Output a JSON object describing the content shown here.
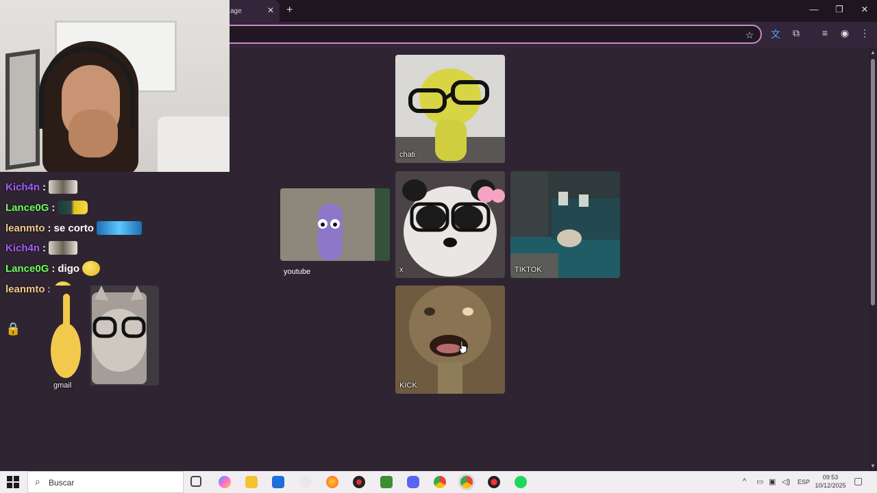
{
  "browser": {
    "tab_title": "age",
    "tab_close": "✕",
    "new_tab": "+",
    "minimize": "—",
    "restore": "❐",
    "close": "✕",
    "bookmark_icon": "☆",
    "translate_icon": "文",
    "extensions_icon": "⧉",
    "media_icon": "≡",
    "profile_icon": "◉",
    "menu_icon": "⋮"
  },
  "chat": {
    "separator": ":",
    "lines": [
      {
        "user": "Kich4n",
        "color": "#a45cff",
        "message": ""
      },
      {
        "user": "Lance0G",
        "color": "#6cff5a",
        "message": ""
      },
      {
        "user": "leanmto",
        "color": "#f3c98b",
        "message": "se corto"
      },
      {
        "user": "Kich4n",
        "color": "#a45cff",
        "message": ""
      },
      {
        "user": "Lance0G",
        "color": "#6cff5a",
        "message": "digo"
      },
      {
        "user": "leanmto",
        "color": "#f3c98b",
        "message": ""
      }
    ],
    "lock_icon": "🔒"
  },
  "tiles": [
    {
      "label": "chati"
    },
    {
      "label": "youtube"
    },
    {
      "label": "x"
    },
    {
      "label": "TIKTOK"
    },
    {
      "label": "KICK"
    },
    {
      "label": "gmail"
    }
  ],
  "taskbar": {
    "search_placeholder": "Buscar",
    "language": "ESP",
    "time": "09:53",
    "date": "10/12/2025",
    "tray_up_icon": "^"
  }
}
